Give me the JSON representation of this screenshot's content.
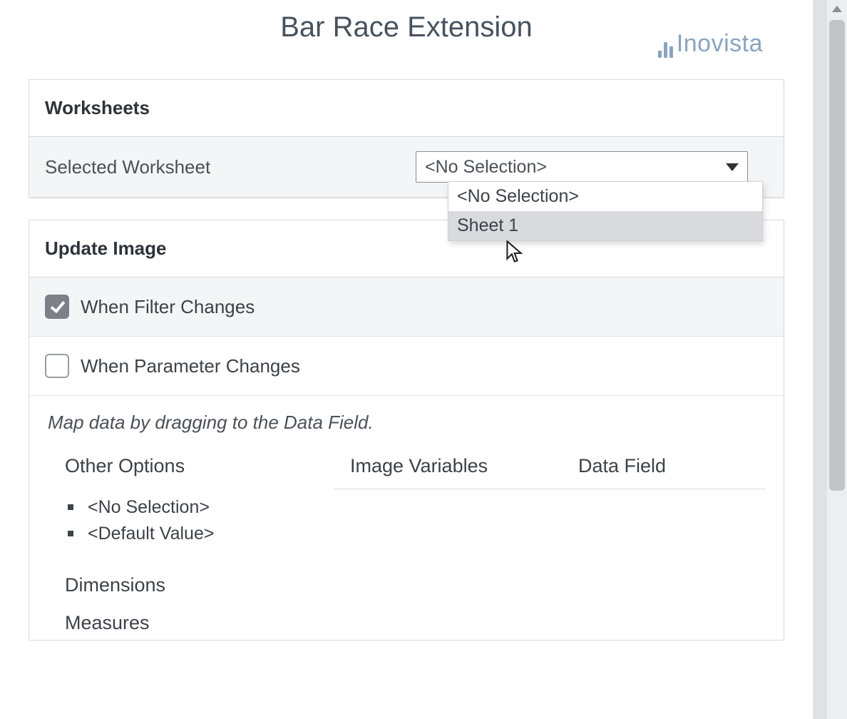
{
  "header": {
    "title": "Bar Race Extension",
    "brand": "Inovista"
  },
  "worksheets": {
    "panel_title": "Worksheets",
    "selected_label": "Selected Worksheet",
    "select_value": "<No Selection>",
    "options": [
      "<No Selection>",
      "Sheet 1"
    ]
  },
  "update_image": {
    "panel_title": "Update Image",
    "filter_label": "When Filter Changes",
    "filter_checked": true,
    "param_label": "When Parameter Changes",
    "param_checked": false
  },
  "mapping": {
    "instruction": "Map data by dragging to the Data Field.",
    "col_other": "Other Options",
    "col_vars": "Image Variables",
    "col_field": "Data Field",
    "other_items": [
      "<No Selection>",
      "<Default Value>"
    ],
    "dimensions_label": "Dimensions",
    "measures_label": "Measures"
  }
}
